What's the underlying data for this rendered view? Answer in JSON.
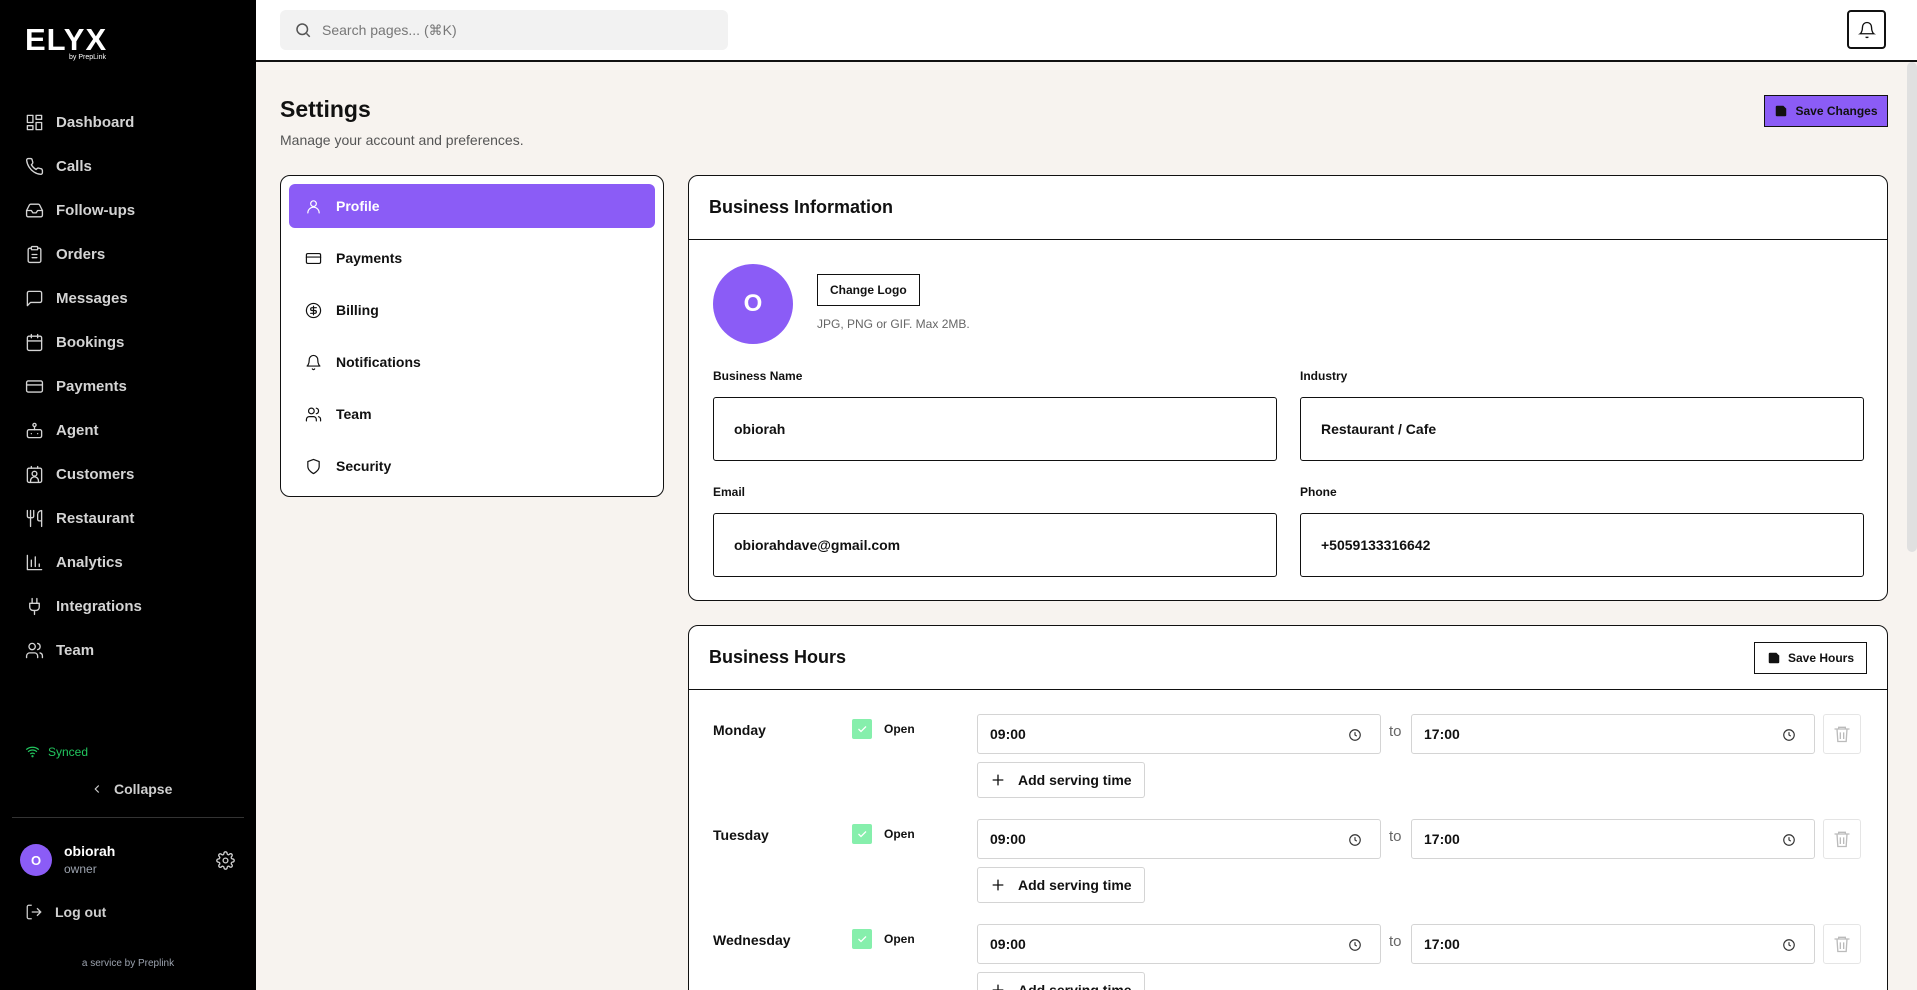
{
  "sidebar": {
    "logo": "ELYX",
    "logo_sub": "by PrepLink",
    "items": [
      {
        "label": "Dashboard",
        "icon": "dashboard-icon"
      },
      {
        "label": "Calls",
        "icon": "phone-icon"
      },
      {
        "label": "Follow-ups",
        "icon": "inbox-icon"
      },
      {
        "label": "Orders",
        "icon": "clipboard-icon"
      },
      {
        "label": "Messages",
        "icon": "message-icon"
      },
      {
        "label": "Bookings",
        "icon": "calendar-icon"
      },
      {
        "label": "Payments",
        "icon": "credit-card-icon"
      },
      {
        "label": "Agent",
        "icon": "bot-icon"
      },
      {
        "label": "Customers",
        "icon": "contact-icon"
      },
      {
        "label": "Restaurant",
        "icon": "utensils-icon"
      },
      {
        "label": "Analytics",
        "icon": "bar-chart-icon"
      },
      {
        "label": "Integrations",
        "icon": "plug-icon"
      },
      {
        "label": "Team",
        "icon": "users-icon"
      }
    ],
    "synced": "Synced",
    "collapse": "Collapse",
    "user": {
      "initial": "O",
      "name": "obiorah",
      "role": "owner"
    },
    "logout": "Log out",
    "footer": "a service by Preplink"
  },
  "topbar": {
    "search_placeholder": "Search pages... (⌘K)"
  },
  "header": {
    "title": "Settings",
    "subtitle": "Manage your account and preferences.",
    "save_button": "Save Changes"
  },
  "settings_menu": [
    {
      "label": "Profile",
      "icon": "user-icon",
      "active": true
    },
    {
      "label": "Payments",
      "icon": "credit-card-icon",
      "active": false
    },
    {
      "label": "Billing",
      "icon": "dollar-circle-icon",
      "active": false
    },
    {
      "label": "Notifications",
      "icon": "bell-icon",
      "active": false
    },
    {
      "label": "Team",
      "icon": "users-icon",
      "active": false
    },
    {
      "label": "Security",
      "icon": "shield-icon",
      "active": false
    }
  ],
  "business_info": {
    "title": "Business Information",
    "logo_initial": "O",
    "change_logo": "Change Logo",
    "logo_hint": "JPG, PNG or GIF. Max 2MB.",
    "fields": {
      "business_name": {
        "label": "Business Name",
        "value": "obiorah"
      },
      "industry": {
        "label": "Industry",
        "value": "Restaurant / Cafe"
      },
      "email": {
        "label": "Email",
        "value": "obiorahdave@gmail.com"
      },
      "phone": {
        "label": "Phone",
        "value": "+5059133316642"
      }
    }
  },
  "business_hours": {
    "title": "Business Hours",
    "save_button": "Save Hours",
    "open_label": "Open",
    "to_label": "to",
    "add_serving": "Add serving time",
    "days": [
      {
        "name": "Monday",
        "open": true,
        "from": "09:00",
        "to": "17:00"
      },
      {
        "name": "Tuesday",
        "open": true,
        "from": "09:00",
        "to": "17:00"
      },
      {
        "name": "Wednesday",
        "open": true,
        "from": "09:00",
        "to": "17:00"
      }
    ]
  },
  "colors": {
    "accent": "#8b5cf6",
    "sidebar_bg": "#000000",
    "page_bg": "#f7f3ef",
    "synced": "#22c55e",
    "checkbox": "#86efac"
  }
}
